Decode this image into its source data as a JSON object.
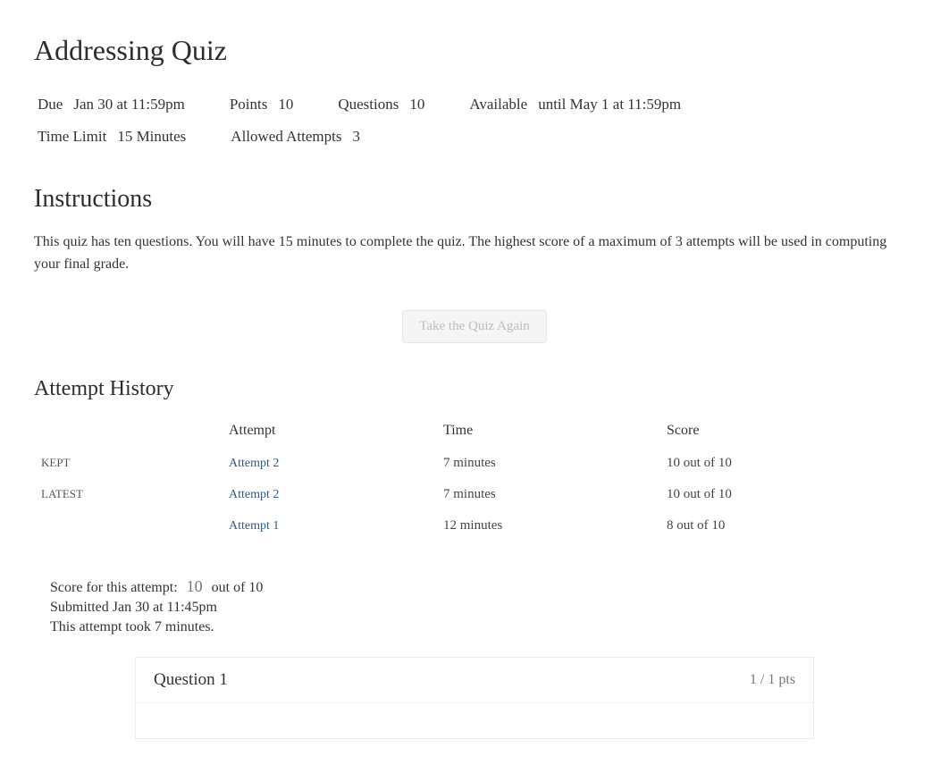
{
  "title": "Addressing Quiz",
  "meta": {
    "due_label": "Due",
    "due_value": "Jan 30 at 11:59pm",
    "points_label": "Points",
    "points_value": "10",
    "questions_label": "Questions",
    "questions_value": "10",
    "available_label": "Available",
    "available_value": "until May 1 at 11:59pm",
    "timelimit_label": "Time Limit",
    "timelimit_value": "15 Minutes",
    "attempts_label": "Allowed Attempts",
    "attempts_value": "3"
  },
  "instructions": {
    "heading": "Instructions",
    "text": "This quiz has ten questions. You will have 15 minutes to complete the quiz. The highest score of a maximum of 3 attempts will be used in computing your final grade."
  },
  "take_again": "Take the Quiz Again",
  "attempt_history": {
    "heading": "Attempt History",
    "columns": {
      "tag": "",
      "attempt": "Attempt",
      "time": "Time",
      "score": "Score"
    },
    "rows": [
      {
        "tag": "KEPT",
        "attempt": "Attempt 2",
        "time": "7 minutes",
        "score": "10 out of 10"
      },
      {
        "tag": "LATEST",
        "attempt": "Attempt 2",
        "time": "7 minutes",
        "score": "10 out of 10"
      },
      {
        "tag": "",
        "attempt": "Attempt 1",
        "time": "12 minutes",
        "score": "8 out of 10"
      }
    ]
  },
  "summary": {
    "score_label": "Score for this attempt:",
    "score_value": "10",
    "score_suffix": "out of 10",
    "submitted": "Submitted Jan 30 at 11:45pm",
    "duration": "This attempt took 7 minutes."
  },
  "question": {
    "title": "Question 1",
    "points": "1 / 1 pts"
  }
}
